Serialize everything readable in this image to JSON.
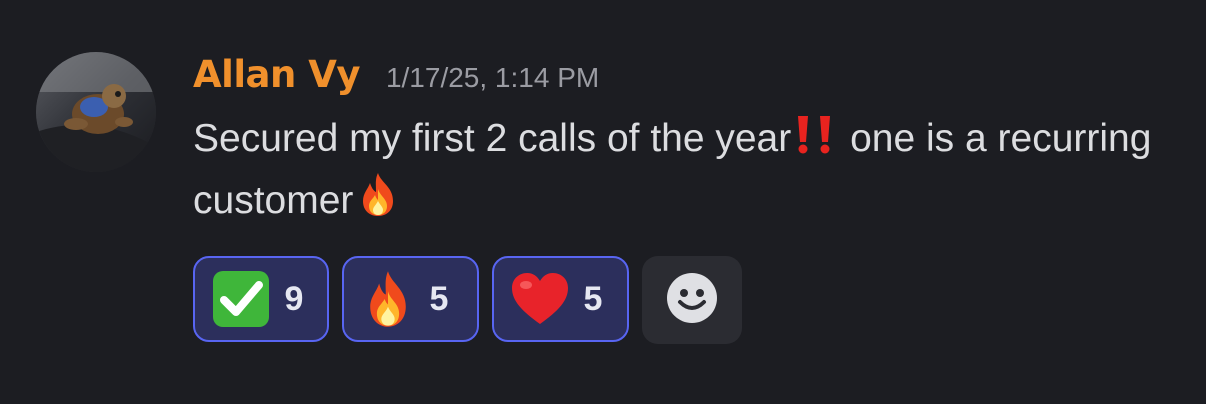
{
  "message": {
    "author": "Allan Vy",
    "timestamp": "1/17/25, 1:14 PM",
    "text_part1": "Secured my first 2 calls of the year",
    "text_part2": " one is a recurring customer",
    "author_color": "#f0902c"
  },
  "reactions": [
    {
      "emoji": "white-check-mark",
      "count": "9"
    },
    {
      "emoji": "fire",
      "count": "5"
    },
    {
      "emoji": "red-heart",
      "count": "5"
    }
  ],
  "add_reaction": {
    "icon": "smiley-icon"
  },
  "colors": {
    "background": "#1c1d22",
    "reaction_border": "#5865f2",
    "reaction_bg": "#2c2f5c"
  }
}
